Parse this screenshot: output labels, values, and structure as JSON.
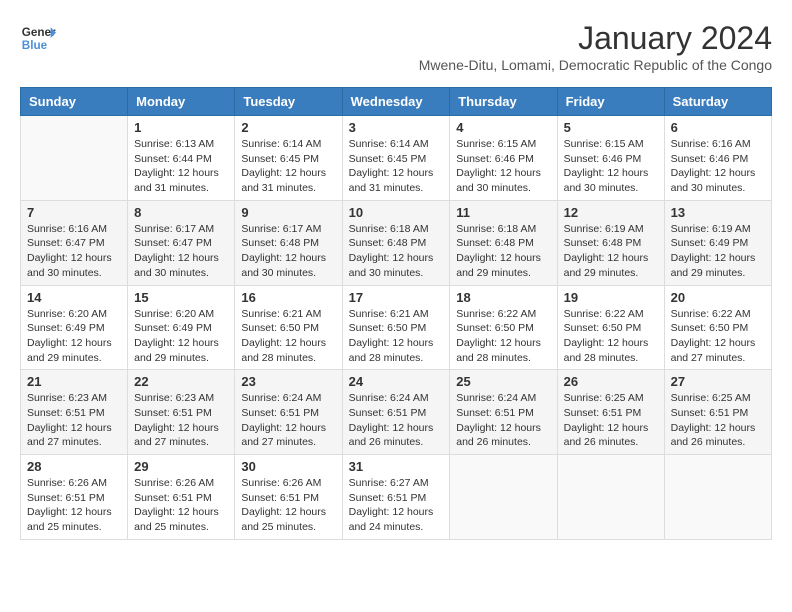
{
  "logo": {
    "line1": "General",
    "line2": "Blue"
  },
  "title": "January 2024",
  "subtitle": "Mwene-Ditu, Lomami, Democratic Republic of the Congo",
  "days_of_week": [
    "Sunday",
    "Monday",
    "Tuesday",
    "Wednesday",
    "Thursday",
    "Friday",
    "Saturday"
  ],
  "weeks": [
    [
      {
        "day": "",
        "info": ""
      },
      {
        "day": "1",
        "info": "Sunrise: 6:13 AM\nSunset: 6:44 PM\nDaylight: 12 hours\nand 31 minutes."
      },
      {
        "day": "2",
        "info": "Sunrise: 6:14 AM\nSunset: 6:45 PM\nDaylight: 12 hours\nand 31 minutes."
      },
      {
        "day": "3",
        "info": "Sunrise: 6:14 AM\nSunset: 6:45 PM\nDaylight: 12 hours\nand 31 minutes."
      },
      {
        "day": "4",
        "info": "Sunrise: 6:15 AM\nSunset: 6:46 PM\nDaylight: 12 hours\nand 30 minutes."
      },
      {
        "day": "5",
        "info": "Sunrise: 6:15 AM\nSunset: 6:46 PM\nDaylight: 12 hours\nand 30 minutes."
      },
      {
        "day": "6",
        "info": "Sunrise: 6:16 AM\nSunset: 6:46 PM\nDaylight: 12 hours\nand 30 minutes."
      }
    ],
    [
      {
        "day": "7",
        "info": "Sunrise: 6:16 AM\nSunset: 6:47 PM\nDaylight: 12 hours\nand 30 minutes."
      },
      {
        "day": "8",
        "info": "Sunrise: 6:17 AM\nSunset: 6:47 PM\nDaylight: 12 hours\nand 30 minutes."
      },
      {
        "day": "9",
        "info": "Sunrise: 6:17 AM\nSunset: 6:48 PM\nDaylight: 12 hours\nand 30 minutes."
      },
      {
        "day": "10",
        "info": "Sunrise: 6:18 AM\nSunset: 6:48 PM\nDaylight: 12 hours\nand 30 minutes."
      },
      {
        "day": "11",
        "info": "Sunrise: 6:18 AM\nSunset: 6:48 PM\nDaylight: 12 hours\nand 29 minutes."
      },
      {
        "day": "12",
        "info": "Sunrise: 6:19 AM\nSunset: 6:48 PM\nDaylight: 12 hours\nand 29 minutes."
      },
      {
        "day": "13",
        "info": "Sunrise: 6:19 AM\nSunset: 6:49 PM\nDaylight: 12 hours\nand 29 minutes."
      }
    ],
    [
      {
        "day": "14",
        "info": "Sunrise: 6:20 AM\nSunset: 6:49 PM\nDaylight: 12 hours\nand 29 minutes."
      },
      {
        "day": "15",
        "info": "Sunrise: 6:20 AM\nSunset: 6:49 PM\nDaylight: 12 hours\nand 29 minutes."
      },
      {
        "day": "16",
        "info": "Sunrise: 6:21 AM\nSunset: 6:50 PM\nDaylight: 12 hours\nand 28 minutes."
      },
      {
        "day": "17",
        "info": "Sunrise: 6:21 AM\nSunset: 6:50 PM\nDaylight: 12 hours\nand 28 minutes."
      },
      {
        "day": "18",
        "info": "Sunrise: 6:22 AM\nSunset: 6:50 PM\nDaylight: 12 hours\nand 28 minutes."
      },
      {
        "day": "19",
        "info": "Sunrise: 6:22 AM\nSunset: 6:50 PM\nDaylight: 12 hours\nand 28 minutes."
      },
      {
        "day": "20",
        "info": "Sunrise: 6:22 AM\nSunset: 6:50 PM\nDaylight: 12 hours\nand 27 minutes."
      }
    ],
    [
      {
        "day": "21",
        "info": "Sunrise: 6:23 AM\nSunset: 6:51 PM\nDaylight: 12 hours\nand 27 minutes."
      },
      {
        "day": "22",
        "info": "Sunrise: 6:23 AM\nSunset: 6:51 PM\nDaylight: 12 hours\nand 27 minutes."
      },
      {
        "day": "23",
        "info": "Sunrise: 6:24 AM\nSunset: 6:51 PM\nDaylight: 12 hours\nand 27 minutes."
      },
      {
        "day": "24",
        "info": "Sunrise: 6:24 AM\nSunset: 6:51 PM\nDaylight: 12 hours\nand 26 minutes."
      },
      {
        "day": "25",
        "info": "Sunrise: 6:24 AM\nSunset: 6:51 PM\nDaylight: 12 hours\nand 26 minutes."
      },
      {
        "day": "26",
        "info": "Sunrise: 6:25 AM\nSunset: 6:51 PM\nDaylight: 12 hours\nand 26 minutes."
      },
      {
        "day": "27",
        "info": "Sunrise: 6:25 AM\nSunset: 6:51 PM\nDaylight: 12 hours\nand 26 minutes."
      }
    ],
    [
      {
        "day": "28",
        "info": "Sunrise: 6:26 AM\nSunset: 6:51 PM\nDaylight: 12 hours\nand 25 minutes."
      },
      {
        "day": "29",
        "info": "Sunrise: 6:26 AM\nSunset: 6:51 PM\nDaylight: 12 hours\nand 25 minutes."
      },
      {
        "day": "30",
        "info": "Sunrise: 6:26 AM\nSunset: 6:51 PM\nDaylight: 12 hours\nand 25 minutes."
      },
      {
        "day": "31",
        "info": "Sunrise: 6:27 AM\nSunset: 6:51 PM\nDaylight: 12 hours\nand 24 minutes."
      },
      {
        "day": "",
        "info": ""
      },
      {
        "day": "",
        "info": ""
      },
      {
        "day": "",
        "info": ""
      }
    ]
  ]
}
